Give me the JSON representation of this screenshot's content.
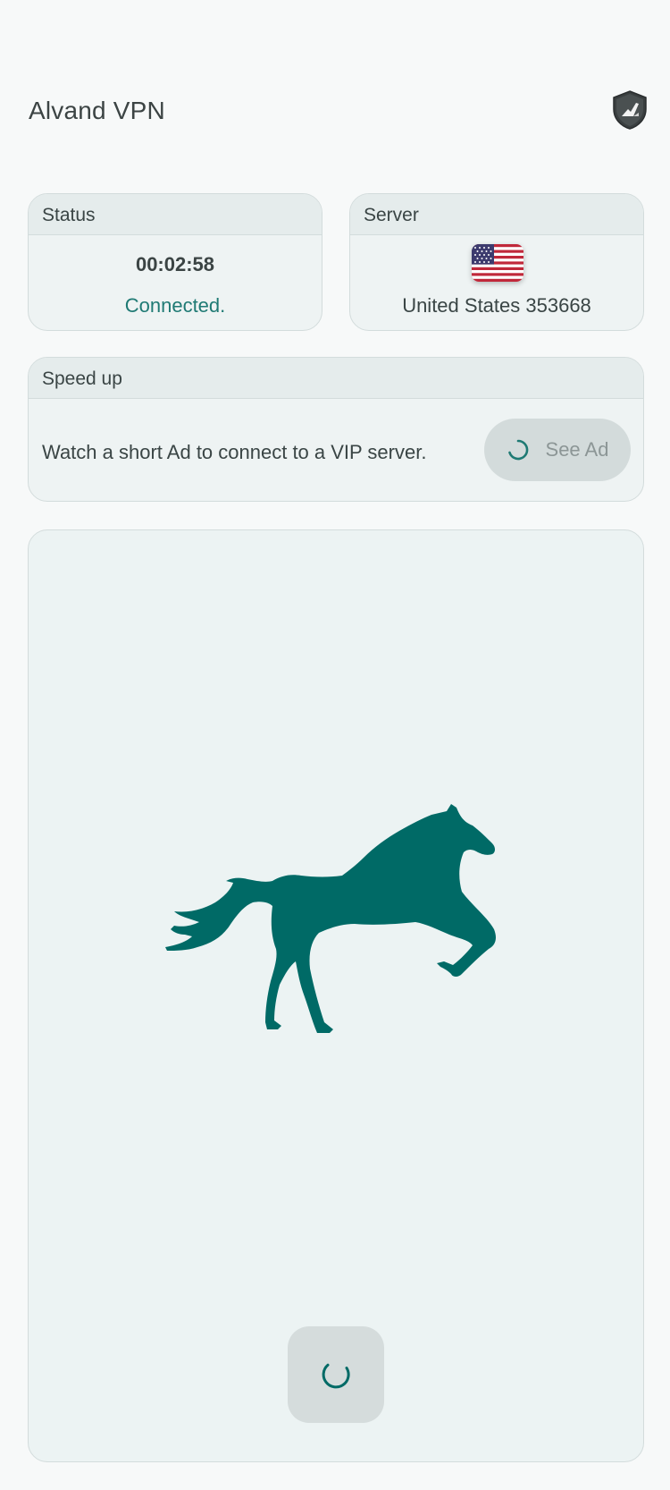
{
  "header": {
    "title": "Alvand VPN",
    "shield_icon": "shield-icon"
  },
  "status": {
    "label": "Status",
    "timer": "00:02:58",
    "state": "Connected."
  },
  "server": {
    "label": "Server",
    "flag_icon": "us-flag-icon",
    "name": "United States 353668"
  },
  "speed_up": {
    "label": "Speed up",
    "description": "Watch a short Ad to connect to a VIP server.",
    "button_label": "See Ad"
  },
  "main": {
    "image": "horse-icon",
    "connect_button_icon": "loading-spinner-icon"
  },
  "colors": {
    "accent": "#006a66",
    "status_connected": "#1f7a74",
    "card_bg": "#eef3f3",
    "header_bg": "#e5ecec"
  }
}
